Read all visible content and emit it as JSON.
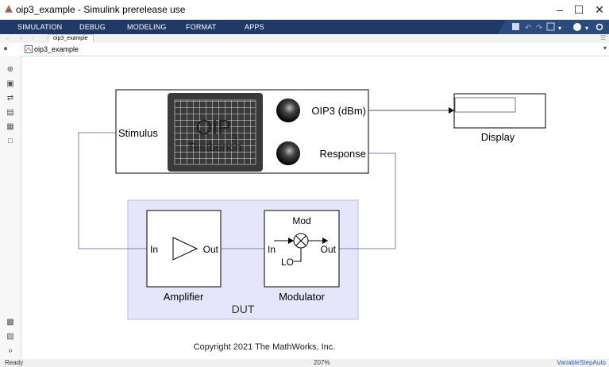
{
  "window": {
    "title": "oip3_example - Simulink prerelease use"
  },
  "ribbon": {
    "tabs": [
      "SIMULATION",
      "DEBUG",
      "MODELING",
      "FORMAT",
      "APPS"
    ]
  },
  "nav": {
    "breadcrumb": "oip3_example"
  },
  "address": {
    "model": "oip3_example"
  },
  "testbench": {
    "screen_line1": "OIP",
    "screen_sub": "3",
    "screen_line2": "Testbench",
    "port_stimulus": "Stimulus",
    "port_oip3": "OIP3 (dBm)",
    "port_response": "Response"
  },
  "display": {
    "label": "Display"
  },
  "amplifier": {
    "in": "In",
    "out": "Out",
    "label": "Amplifier"
  },
  "modulator": {
    "mod": "Mod",
    "in": "In",
    "out": "Out",
    "lo": "LO",
    "label": "Modulator"
  },
  "dut": {
    "label": "DUT"
  },
  "copyright": "Copyright 2021 The MathWorks, Inc.",
  "status": {
    "left": "Ready",
    "zoom": "207%",
    "solver": "VariableStepAuto"
  },
  "colors": {
    "ribbon": "#1f3a67",
    "dut_fill": "#e6e6fa",
    "dut_border": "#b9b9e6",
    "wire": "#7f7fb2",
    "status_link": "#2a5fb0"
  }
}
